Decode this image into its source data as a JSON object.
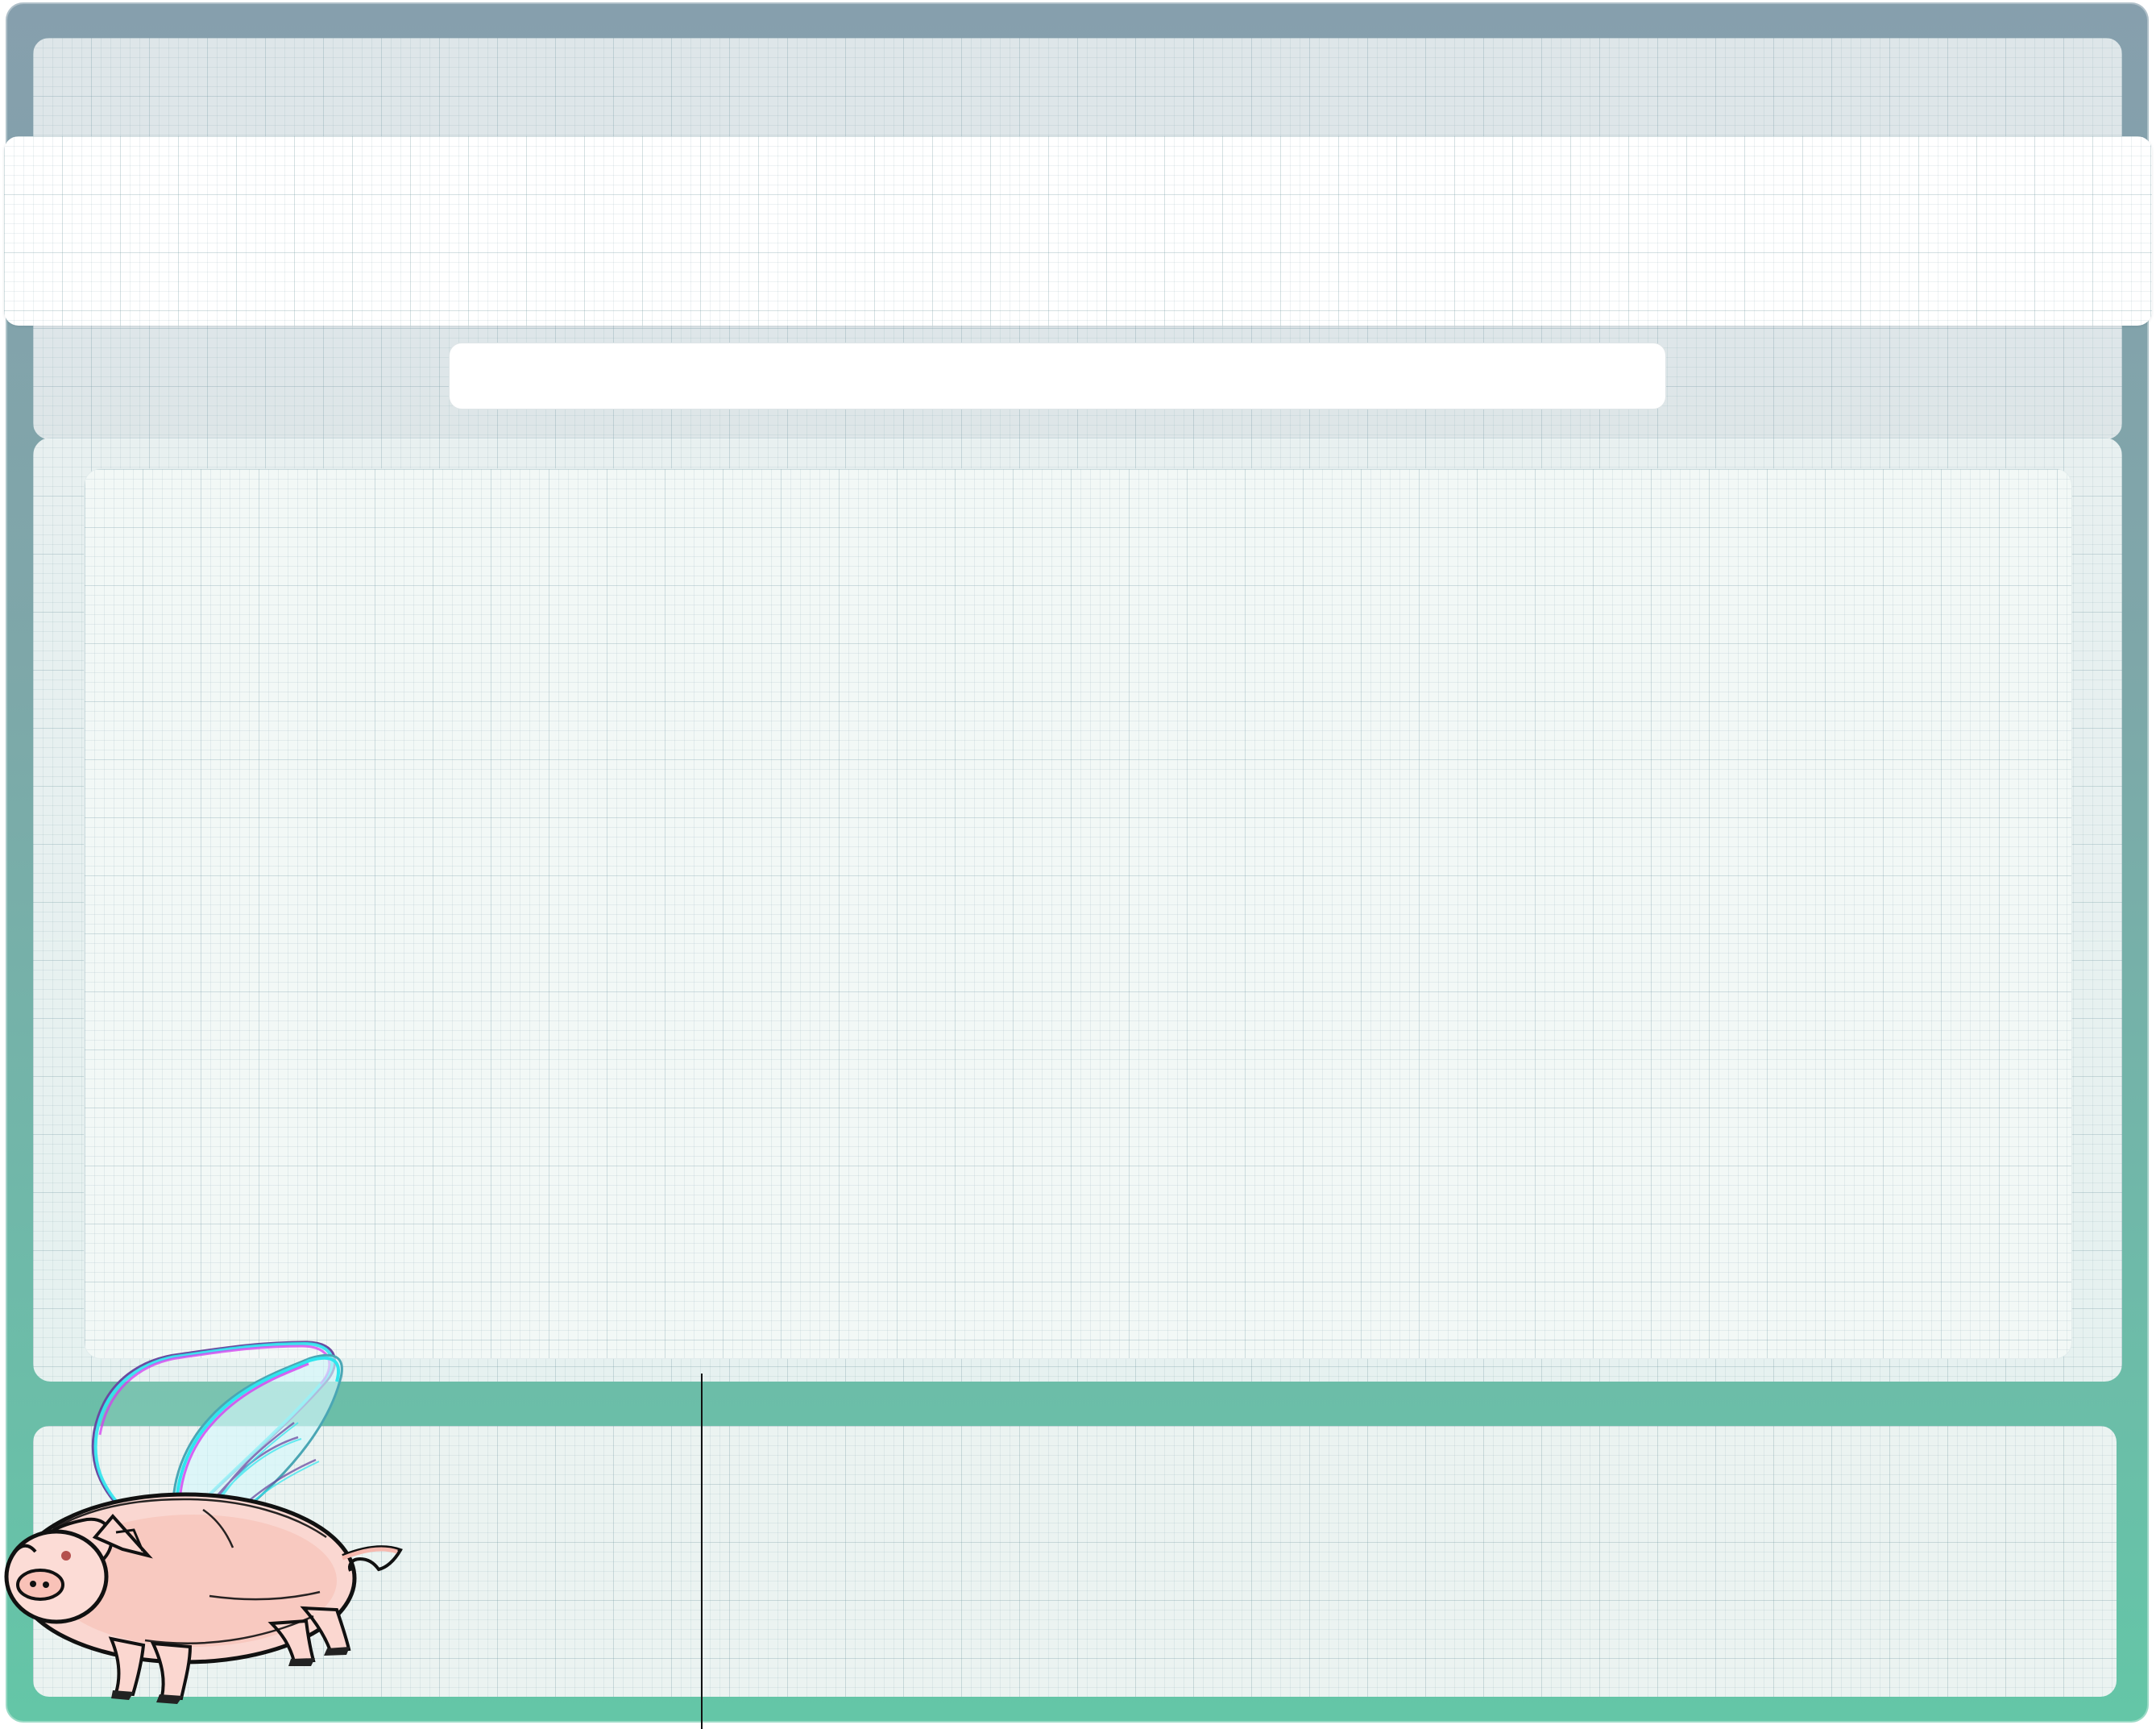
{
  "colors": {
    "window_top": "#869fad",
    "window_bottom": "#64c6a7",
    "panel_light": "#f2f8f6",
    "header_white": "#ffffff",
    "pig_pink": "#f9d0c6",
    "pig_outline": "#111111",
    "wing_cyan": "#2ee6ee",
    "wing_magenta": "#d43ef0"
  },
  "icons": {
    "mascot": "flying-pig-icon"
  }
}
